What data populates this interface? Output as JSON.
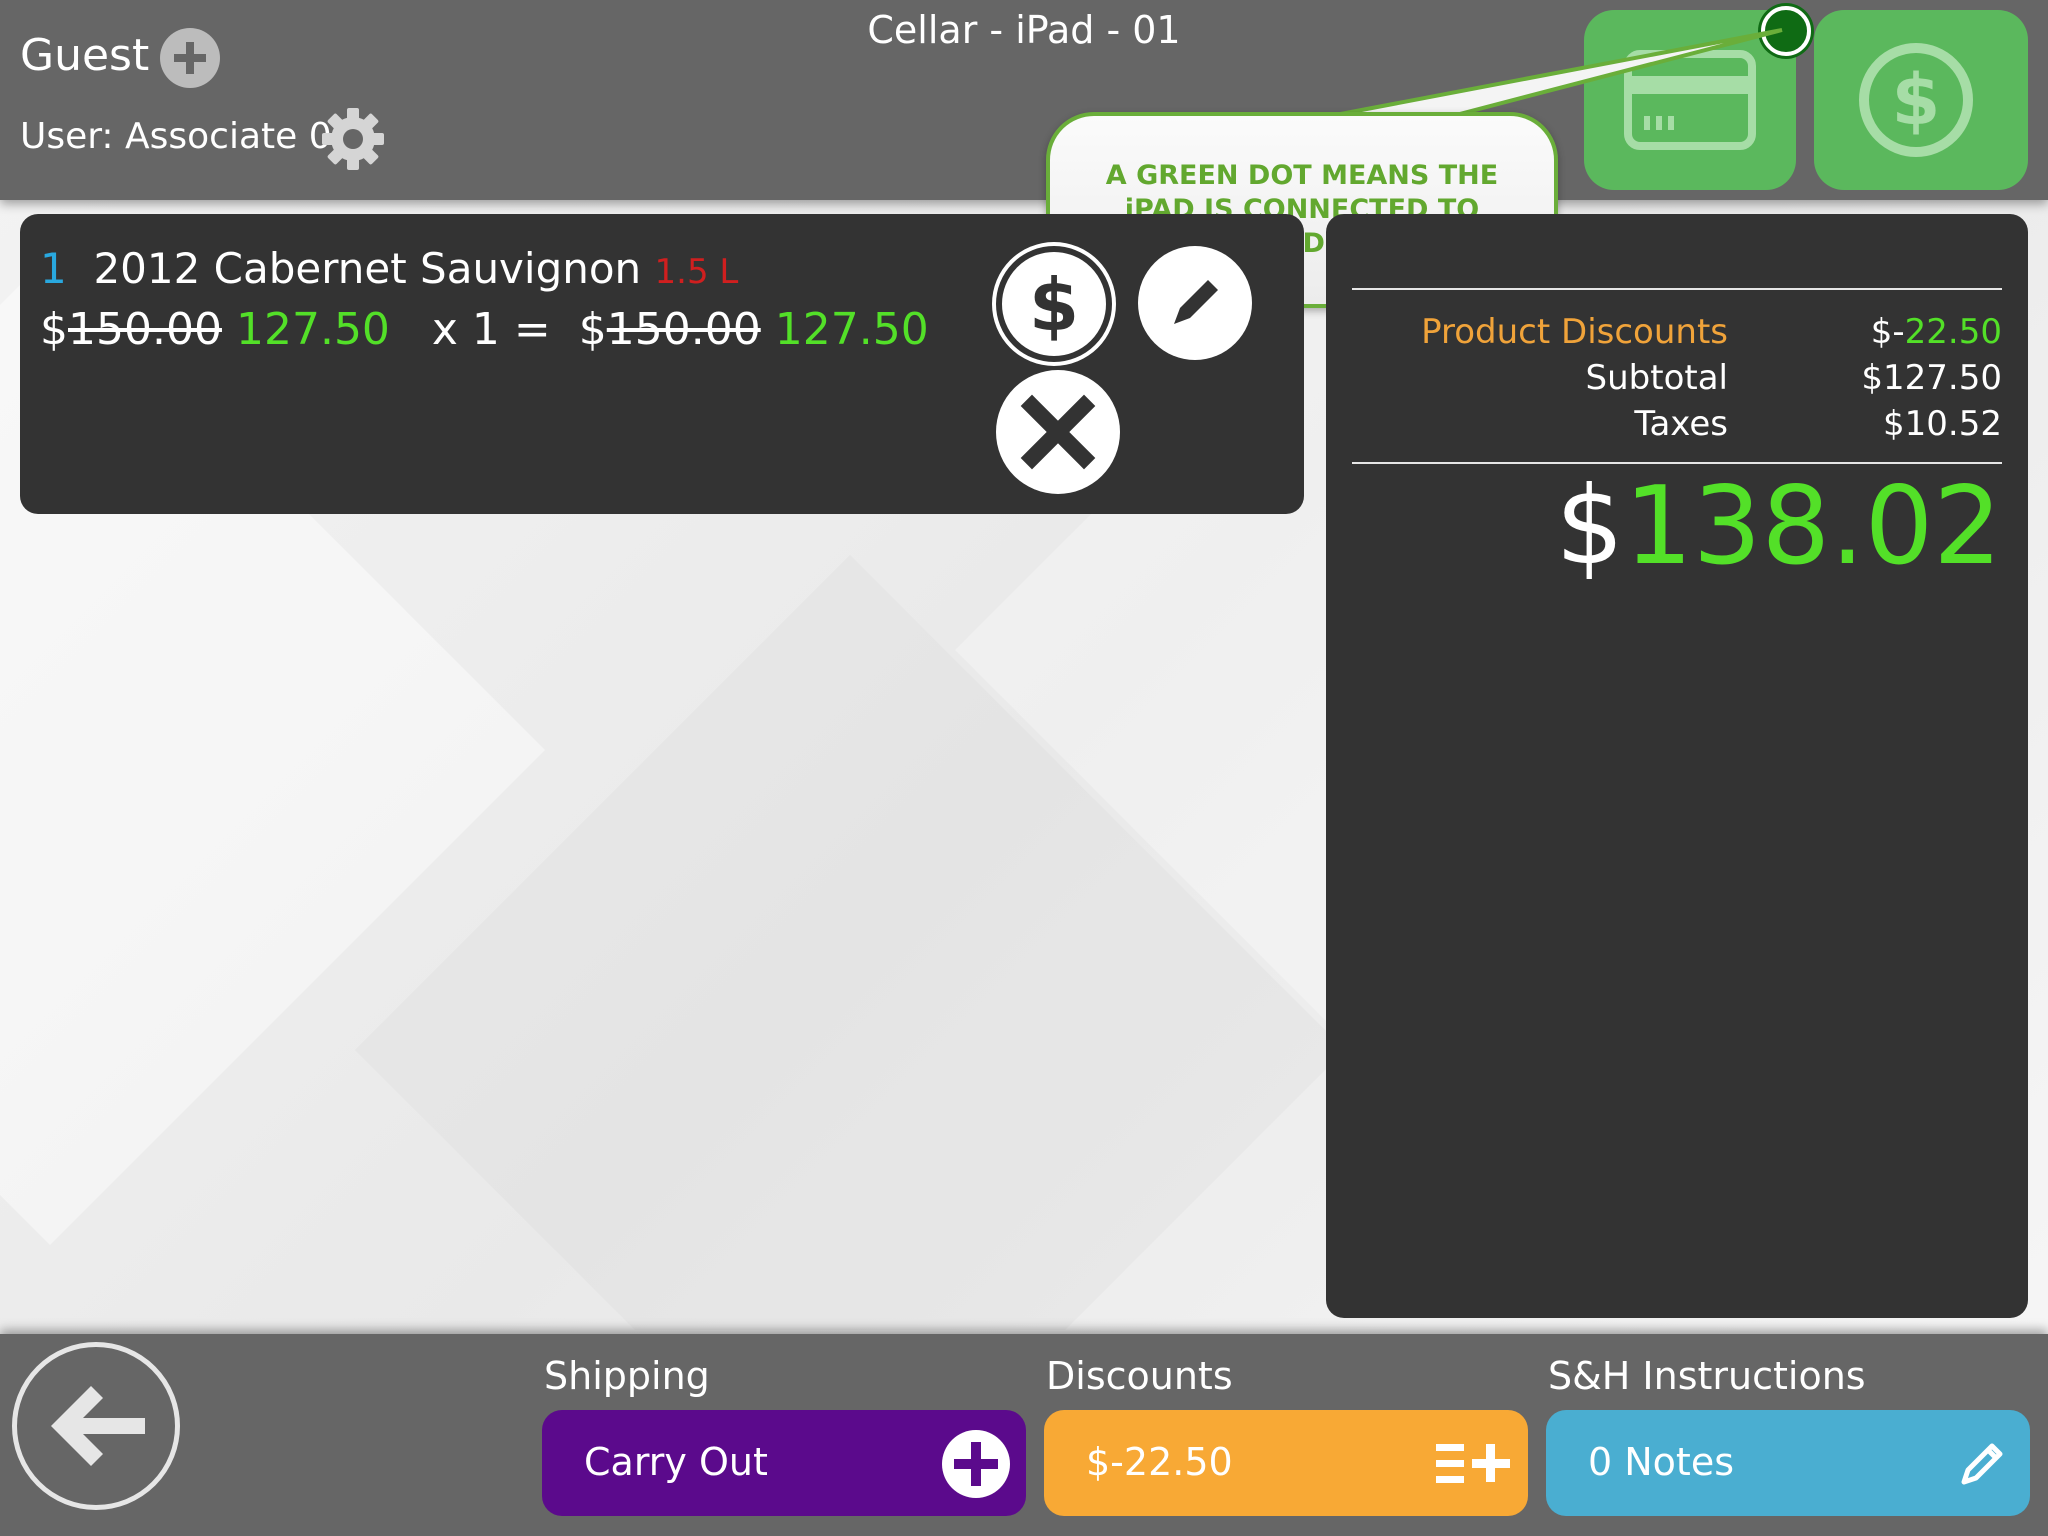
{
  "header": {
    "guest_label": "Guest",
    "user_label": "User: Associate 01",
    "device_title": "Cellar - iPad - 01",
    "card_reader_status": "connected",
    "status_color": "#0f6b14"
  },
  "callout": {
    "text": "A GREEN DOT MEANS THE iPAD IS CONNECTED TO THE CARD SWIPE"
  },
  "cart": {
    "items": [
      {
        "quantity": "1",
        "name": "2012 Cabernet Sauvignon",
        "size": "1.5 L",
        "currency": "$",
        "original_price": "150.00",
        "sale_price": "127.50",
        "multiplier": "x 1 =",
        "original_total": "150.00",
        "sale_total": "127.50"
      }
    ]
  },
  "totals": {
    "product_discounts_label": "Product Discounts",
    "product_discounts_prefix": "$-",
    "product_discounts_value": "22.50",
    "subtotal_label": "Subtotal",
    "subtotal_value": "$127.50",
    "taxes_label": "Taxes",
    "taxes_value": "$10.52",
    "grand_currency": "$",
    "grand_total": "138.02"
  },
  "footer": {
    "shipping_label": "Shipping",
    "shipping_value": "Carry Out",
    "discounts_label": "Discounts",
    "discounts_value": "$-22.50",
    "instructions_label": "S&H Instructions",
    "instructions_value": "0 Notes"
  },
  "colors": {
    "accent_green": "#53e028",
    "header_gray": "#666666",
    "panel_dark": "#333333",
    "shipping_purple": "#5b0a8c",
    "discount_orange": "#f8a935",
    "notes_blue": "#4aaed1",
    "button_green": "#5bb85d"
  }
}
